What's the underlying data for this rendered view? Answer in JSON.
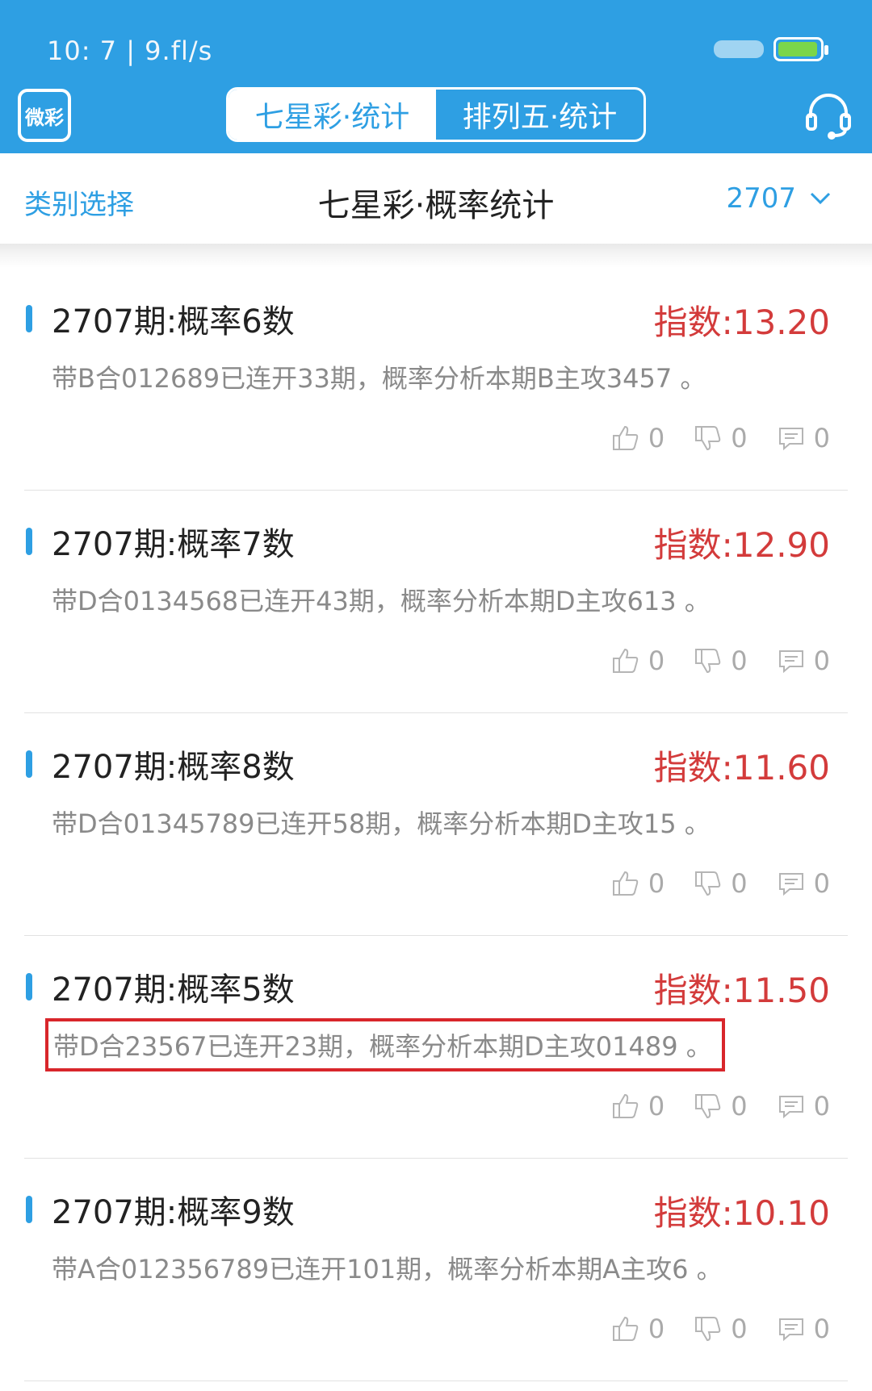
{
  "status_bar": {
    "left_text": "10: 7 | 9.fl/s"
  },
  "app": {
    "logo_text": "微彩"
  },
  "tabs": [
    {
      "label": "七星彩·统计",
      "active": true
    },
    {
      "label": "排列五·统计",
      "active": false
    }
  ],
  "subheader": {
    "category_label": "类别选择",
    "title": "七星彩·概率统计",
    "issue": "2707"
  },
  "colors": {
    "brand": "#2e9fe3",
    "index_red": "#d33b3b",
    "highlight_box": "#d8262b"
  },
  "items": [
    {
      "title": "2707期:概率6数",
      "index": "指数:13.20",
      "desc": "带B合012689已连开33期，概率分析本期B主攻3457 。",
      "likes": "0",
      "dislikes": "0",
      "comments": "0"
    },
    {
      "title": "2707期:概率7数",
      "index": "指数:12.90",
      "desc": "带D合0134568已连开43期，概率分析本期D主攻613 。",
      "likes": "0",
      "dislikes": "0",
      "comments": "0"
    },
    {
      "title": "2707期:概率8数",
      "index": "指数:11.60",
      "desc": "带D合01345789已连开58期，概率分析本期D主攻15 。",
      "likes": "0",
      "dislikes": "0",
      "comments": "0"
    },
    {
      "title": "2707期:概率5数",
      "index": "指数:11.50",
      "desc": "带D合23567已连开23期，概率分析本期D主攻01489 。",
      "likes": "0",
      "dislikes": "0",
      "comments": "0",
      "highlighted": true
    },
    {
      "title": "2707期:概率9数",
      "index": "指数:10.10",
      "desc": "带A合012356789已连开101期，概率分析本期A主攻6 。",
      "likes": "0",
      "dislikes": "0",
      "comments": "0"
    }
  ]
}
